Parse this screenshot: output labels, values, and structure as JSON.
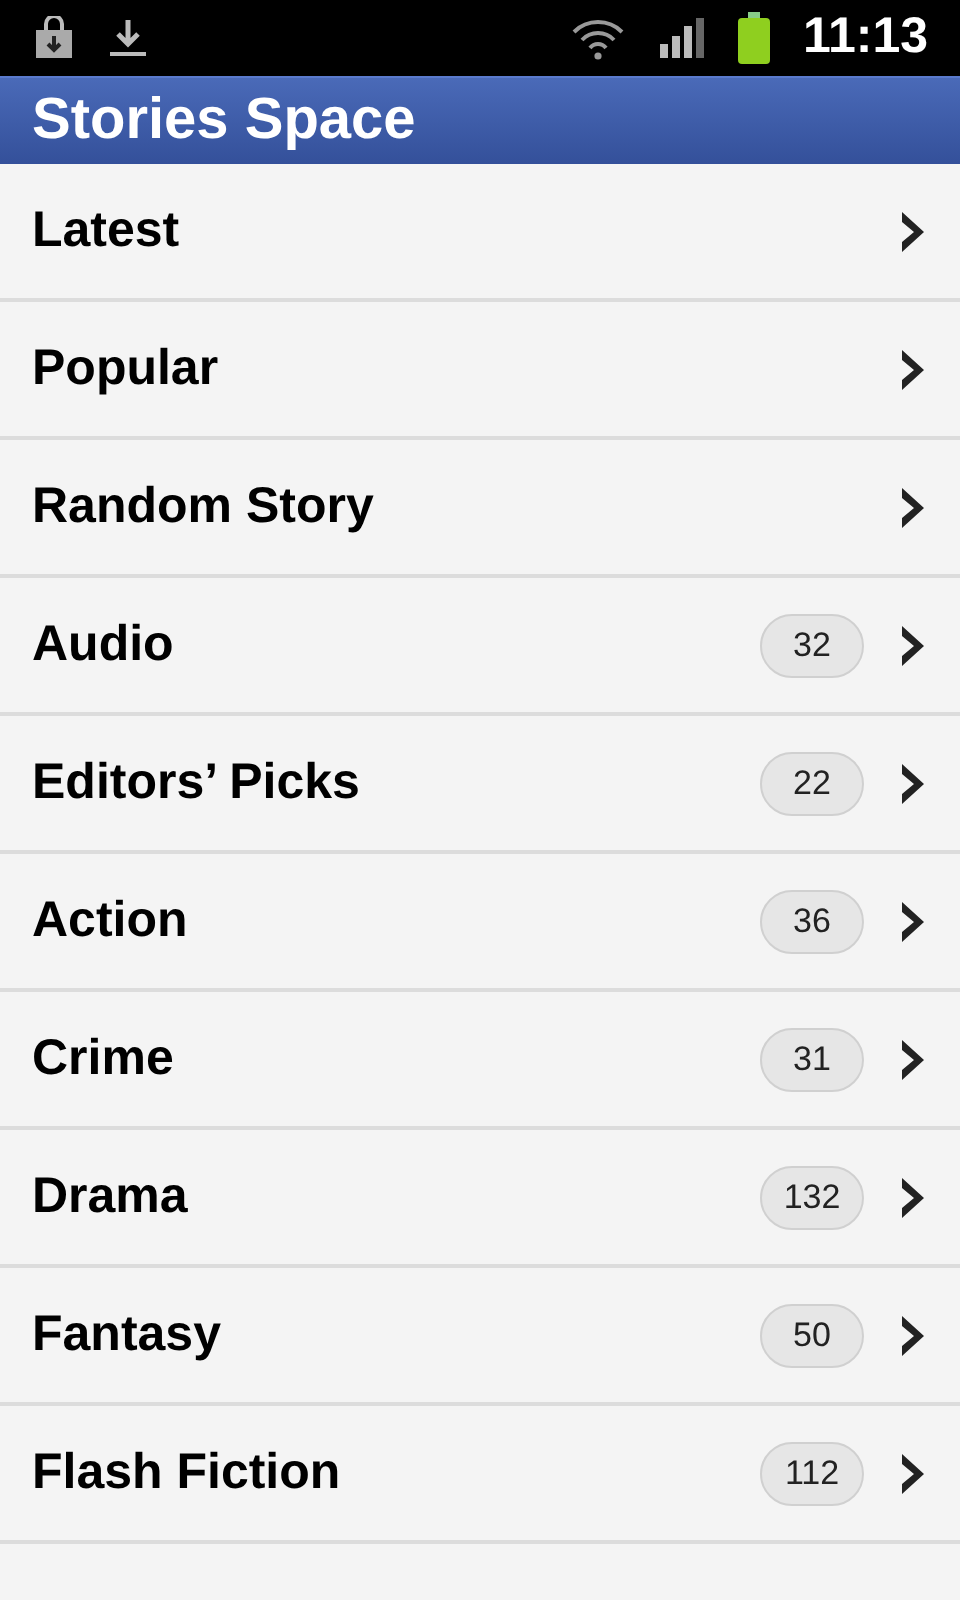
{
  "status_bar": {
    "time": "11:13"
  },
  "app_bar": {
    "title": "Stories Space"
  },
  "items": [
    {
      "label": "Latest"
    },
    {
      "label": "Popular"
    },
    {
      "label": "Random Story"
    },
    {
      "label": "Audio",
      "count": "32"
    },
    {
      "label": "Editors’ Picks",
      "count": "22"
    },
    {
      "label": "Action",
      "count": "36"
    },
    {
      "label": "Crime",
      "count": "31"
    },
    {
      "label": "Drama",
      "count": "132"
    },
    {
      "label": "Fantasy",
      "count": "50"
    },
    {
      "label": "Flash Fiction",
      "count": "112"
    }
  ]
}
